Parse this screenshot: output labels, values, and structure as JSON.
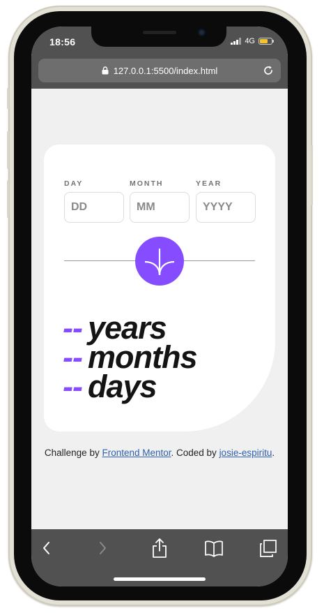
{
  "status_bar": {
    "time": "18:56",
    "network": "4G"
  },
  "browser": {
    "url": "127.0.0.1:5500/index.html"
  },
  "form": {
    "day": {
      "label": "DAY",
      "placeholder": "DD",
      "value": ""
    },
    "month": {
      "label": "MONTH",
      "placeholder": "MM",
      "value": ""
    },
    "year": {
      "label": "YEAR",
      "placeholder": "YYYY",
      "value": ""
    },
    "submit_icon": "arrow-down-icon"
  },
  "results": {
    "years": {
      "value": "--",
      "unit": "years"
    },
    "months": {
      "value": "--",
      "unit": "months"
    },
    "days": {
      "value": "--",
      "unit": "days"
    }
  },
  "footer": {
    "prefix": "Challenge by ",
    "link1": "Frontend Mentor",
    "middle": ". Coded by ",
    "link2": "josie-espiritu",
    "suffix": "."
  },
  "toolbar": {
    "icons": [
      "back-icon",
      "forward-icon",
      "share-icon",
      "bookmarks-icon",
      "tabs-icon"
    ]
  },
  "colors": {
    "accent": "#854dff",
    "background": "#f0f0f0",
    "card": "#ffffff",
    "text": "#141414"
  }
}
